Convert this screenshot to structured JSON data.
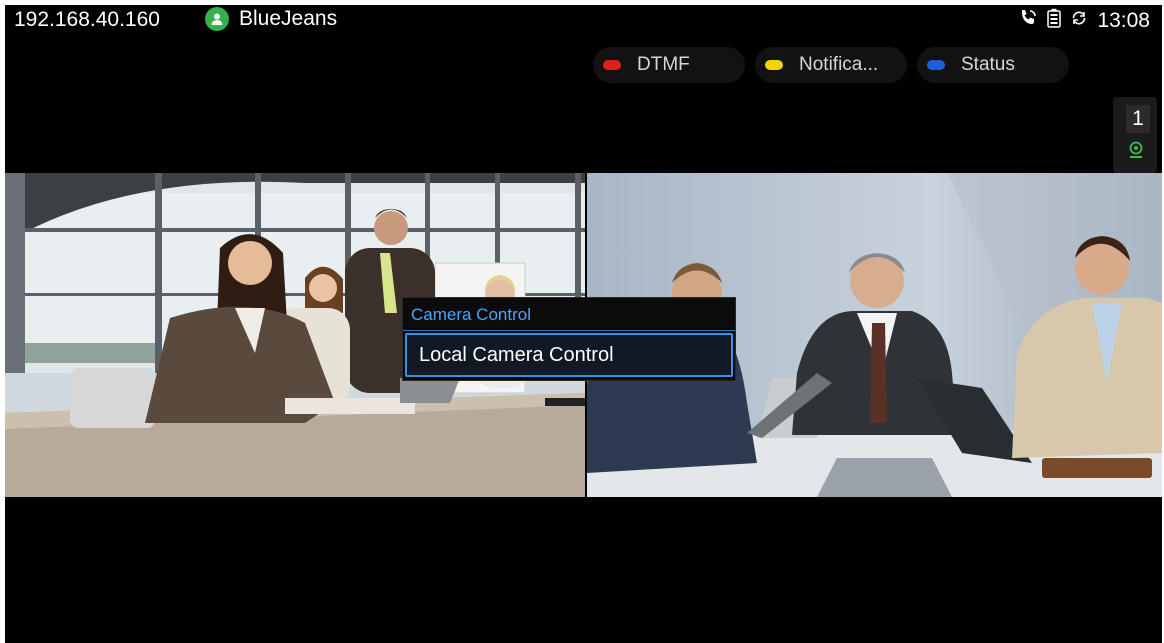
{
  "status_bar": {
    "ip_address": "192.168.40.160",
    "account_name": "BlueJeans",
    "time": "13:08",
    "icons": [
      "account-icon",
      "call-icon",
      "battery-icon",
      "sync-icon"
    ]
  },
  "softkeys": [
    {
      "label": "DTMF",
      "color": "#e0201e"
    },
    {
      "label": "Notifica...",
      "color": "#f2d600"
    },
    {
      "label": "Status",
      "color": "#1f5fd6"
    }
  ],
  "participants": {
    "count": "1",
    "camera_icon": "camera-indicator-icon"
  },
  "popup": {
    "title": "Camera Control",
    "items": [
      {
        "label": "Local Camera Control"
      }
    ]
  },
  "colors": {
    "background": "#000000",
    "accent": "#3d8fe6",
    "account_green": "#35b04a"
  }
}
